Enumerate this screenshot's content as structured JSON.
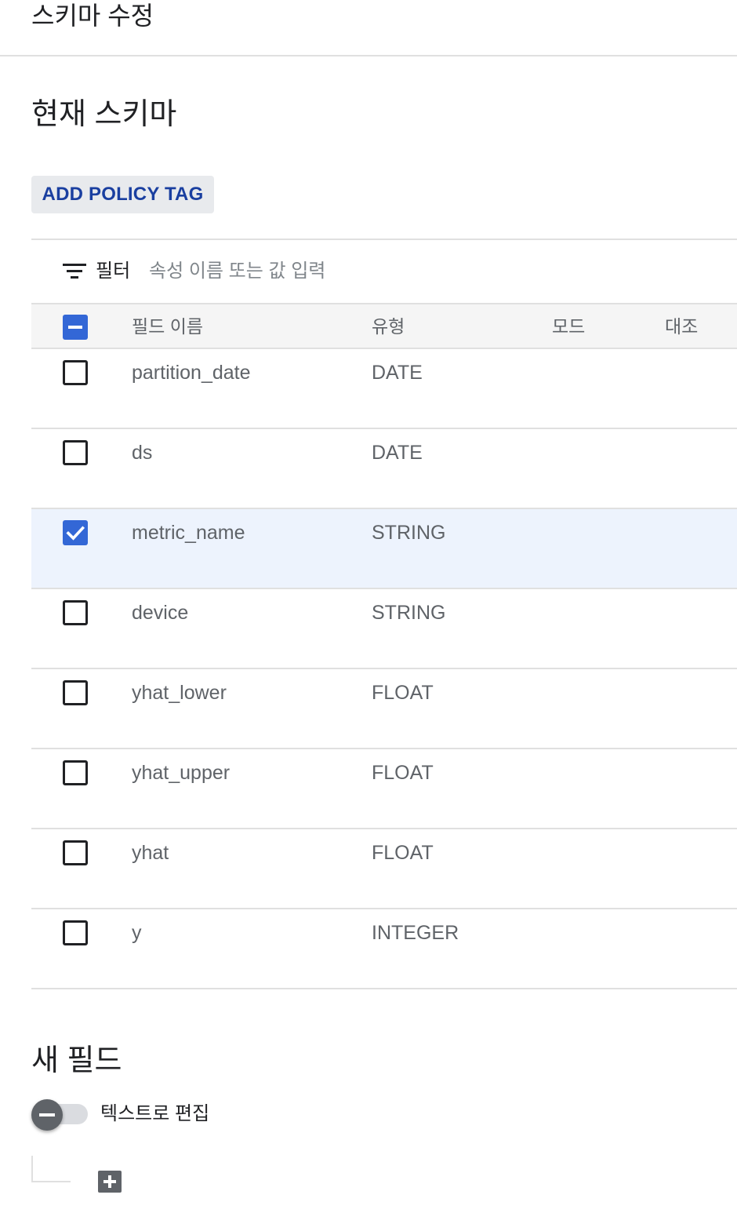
{
  "header": {
    "title": "스키마 수정"
  },
  "current_schema": {
    "title": "현재 스키마",
    "add_policy_tag_label": "ADD POLICY TAG",
    "filter": {
      "label": "필터",
      "placeholder": "속성 이름 또는 값 입력",
      "icon": "filter-icon"
    },
    "table": {
      "select_all_state": "indeterminate",
      "columns": {
        "name": "필드 이름",
        "type": "유형",
        "mode": "모드",
        "reference": "대조"
      },
      "rows": [
        {
          "name": "partition_date",
          "type": "DATE",
          "mode": "",
          "reference": "",
          "checked": false
        },
        {
          "name": "ds",
          "type": "DATE",
          "mode": "",
          "reference": "",
          "checked": false
        },
        {
          "name": "metric_name",
          "type": "STRING",
          "mode": "",
          "reference": "",
          "checked": true
        },
        {
          "name": "device",
          "type": "STRING",
          "mode": "",
          "reference": "",
          "checked": false
        },
        {
          "name": "yhat_lower",
          "type": "FLOAT",
          "mode": "",
          "reference": "",
          "checked": false
        },
        {
          "name": "yhat_upper",
          "type": "FLOAT",
          "mode": "",
          "reference": "",
          "checked": false
        },
        {
          "name": "yhat",
          "type": "FLOAT",
          "mode": "",
          "reference": "",
          "checked": false
        },
        {
          "name": "y",
          "type": "INTEGER",
          "mode": "",
          "reference": "",
          "checked": false
        }
      ]
    }
  },
  "new_field": {
    "title": "새 필드",
    "edit_as_text_label": "텍스트로 편집",
    "edit_as_text_on": false,
    "add_icon": "plus-icon"
  },
  "colors": {
    "accent": "#3367d6",
    "button_text": "#1a3fa0",
    "selected_row": "#edf3fd",
    "header_bg": "#f5f5f5",
    "divider": "#e0e0e0"
  }
}
